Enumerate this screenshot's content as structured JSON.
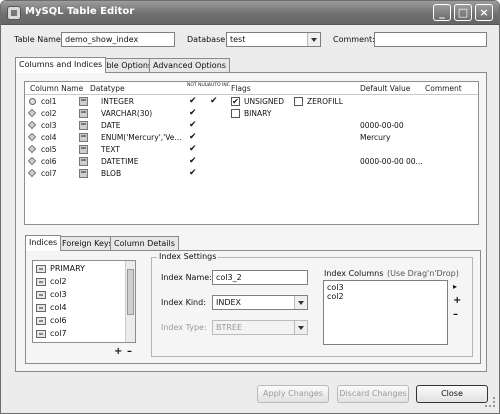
{
  "window": {
    "title": "MySQL Table Editor"
  },
  "top": {
    "table_name_label": "Table Name:",
    "table_name_value": "demo_show_index",
    "database_label": "Database:",
    "database_value": "test",
    "comment_label": "Comment:",
    "comment_value": ""
  },
  "main_tabs": [
    "Columns and Indices",
    "Table Options",
    "Advanced Options"
  ],
  "columns_grid": {
    "headers": {
      "name": "Column Name",
      "datatype": "Datatype",
      "not_null": "NOT NULL",
      "auto_inc": "AUTO INC",
      "flags": "Flags",
      "default": "Default Value",
      "comment": "Comment"
    },
    "check_glyph": "✔",
    "rows": [
      {
        "name": "col1",
        "type": "INTEGER",
        "not_null": true,
        "auto_inc": true,
        "flags": [
          {
            "label": "UNSIGNED",
            "checked": true
          },
          {
            "label": "ZEROFILL",
            "checked": false
          }
        ],
        "default": ""
      },
      {
        "name": "col2",
        "type": "VARCHAR(30)",
        "not_null": true,
        "auto_inc": false,
        "flags": [
          {
            "label": "BINARY",
            "checked": false
          }
        ],
        "default": ""
      },
      {
        "name": "col3",
        "type": "DATE",
        "not_null": true,
        "auto_inc": false,
        "flags": [],
        "default": "0000-00-00"
      },
      {
        "name": "col4",
        "type": "ENUM('Mercury','Ve...",
        "not_null": true,
        "auto_inc": false,
        "flags": [],
        "default": "Mercury"
      },
      {
        "name": "col5",
        "type": "TEXT",
        "not_null": true,
        "auto_inc": false,
        "flags": [],
        "default": ""
      },
      {
        "name": "col6",
        "type": "DATETIME",
        "not_null": true,
        "auto_inc": false,
        "flags": [],
        "default": "0000-00-00 00..."
      },
      {
        "name": "col7",
        "type": "BLOB",
        "not_null": true,
        "auto_inc": false,
        "flags": [],
        "default": ""
      }
    ]
  },
  "sub_tabs": [
    "Indices",
    "Foreign Keys",
    "Column Details"
  ],
  "indices": {
    "items": [
      "PRIMARY",
      "col2",
      "col3",
      "col4",
      "col6",
      "col7"
    ],
    "add_glyph": "+",
    "remove_glyph": "–"
  },
  "index_settings": {
    "legend": "Index Settings",
    "name_label": "Index Name:",
    "name_value": "col3_2",
    "kind_label": "Index Kind:",
    "kind_value": "INDEX",
    "type_label": "Index Type:",
    "type_value": "BTREE",
    "columns_label": "Index Columns",
    "columns_hint": "(Use Drag'n'Drop)",
    "columns": [
      "col3",
      "col2"
    ],
    "move_glyph": "▸",
    "add_glyph": "+",
    "remove_glyph": "–"
  },
  "buttons": {
    "apply": "Apply Changes",
    "discard": "Discard Changes",
    "close": "Close"
  }
}
